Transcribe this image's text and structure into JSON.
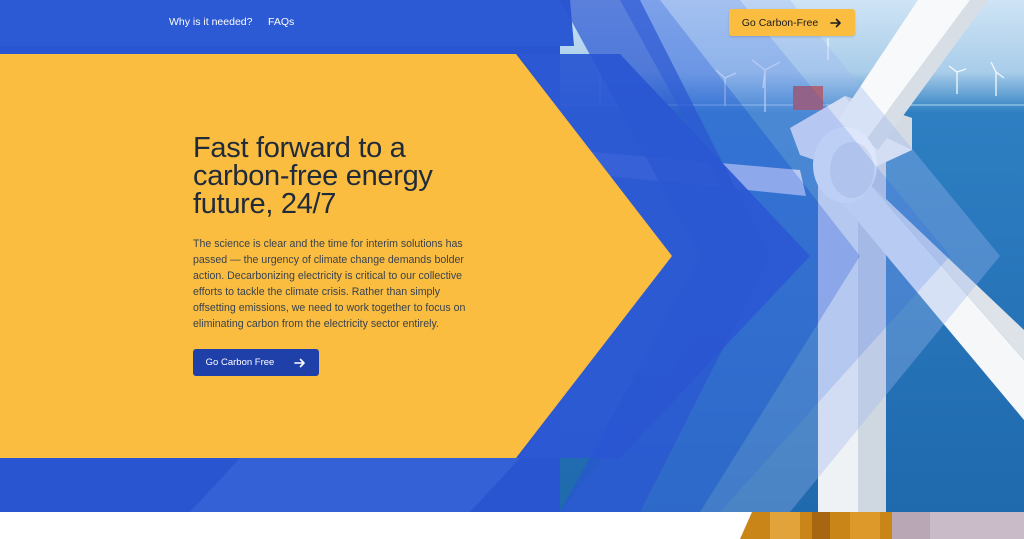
{
  "nav": {
    "links": [
      {
        "label": "Why is it needed?"
      },
      {
        "label": "FAQs"
      }
    ],
    "cta_label": "Go Carbon-Free"
  },
  "hero": {
    "headline": "Fast forward to a carbon-free energy future, 24/7",
    "body": "The science is clear and the time for interim solutions has passed — the urgency of climate change demands bolder action. Decarbonizing electricity is critical to our collective efforts to tackle the climate crisis. Rather than simply offsetting emissions, we need to work together to focus on eliminating carbon from the electricity sector entirely.",
    "cta_label": "Go Carbon Free"
  },
  "colors": {
    "blue": "#2a55d0",
    "dark_blue": "#1f40a8",
    "yellow": "#fbbd40",
    "text_dark": "#1f2a3a"
  },
  "icons": {
    "arrow": "arrow-right-icon",
    "turbine": "wind-turbine-image"
  }
}
